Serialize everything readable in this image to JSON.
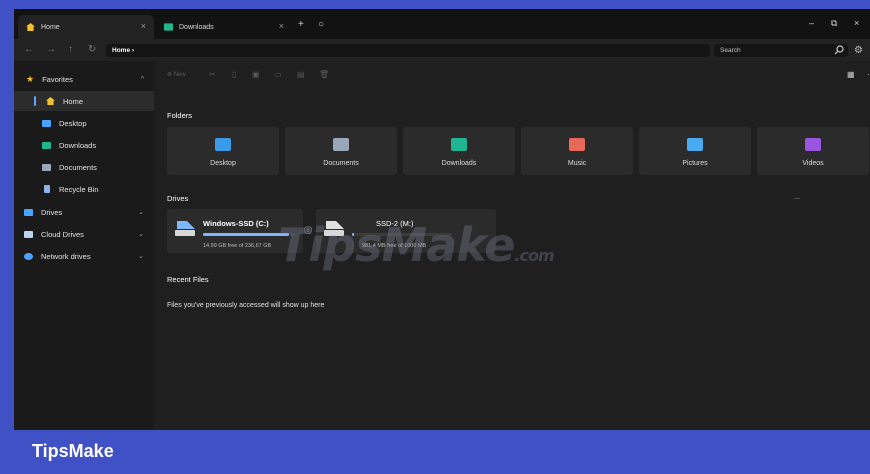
{
  "tabs": [
    {
      "label": "Home",
      "icon": "home-icon",
      "active": true
    },
    {
      "label": "Downloads",
      "icon": "downloads-folder-icon",
      "active": false
    }
  ],
  "window_controls": {
    "minimize": "–",
    "restore": "⧉",
    "close": "×"
  },
  "addressbar": {
    "path": "Home ›",
    "search_placeholder": "Search"
  },
  "sidebar": {
    "items": [
      {
        "label": "Favorites",
        "icon": "star-icon",
        "color": "#f2c12e",
        "chevron": "^"
      },
      {
        "label": "Home",
        "icon": "home-icon",
        "color": "#f2c12e",
        "selected": true
      },
      {
        "label": "Desktop",
        "icon": "desktop-folder-icon",
        "color": "#4aa3ff"
      },
      {
        "label": "Downloads",
        "icon": "downloads-folder-icon",
        "color": "#1fb58f"
      },
      {
        "label": "Documents",
        "icon": "documents-folder-icon",
        "color": "#9aa7b8"
      },
      {
        "label": "Recycle Bin",
        "icon": "recycle-bin-icon",
        "color": "#8fb2e8"
      },
      {
        "label": "Drives",
        "icon": "drive-icon",
        "color": "#4aa3ff",
        "chevron": "⌄"
      },
      {
        "label": "Cloud Drives",
        "icon": "cloud-icon",
        "color": "#bcd3ef",
        "chevron": "⌄"
      },
      {
        "label": "Network drives",
        "icon": "network-icon",
        "color": "#4aa3ff",
        "chevron": "⌄"
      }
    ]
  },
  "toolbar": {
    "new_label": "New"
  },
  "main": {
    "folders_title": "Folders",
    "folders": [
      {
        "label": "Desktop",
        "icon": "desktop-folder-icon",
        "color": "#3c9be8"
      },
      {
        "label": "Documents",
        "icon": "documents-folder-icon",
        "color": "#9aa7b8"
      },
      {
        "label": "Downloads",
        "icon": "downloads-folder-icon",
        "color": "#1fb58f"
      },
      {
        "label": "Music",
        "icon": "music-folder-icon",
        "color": "#e8685a"
      },
      {
        "label": "Pictures",
        "icon": "pictures-folder-icon",
        "color": "#4aa9f0"
      },
      {
        "label": "Videos",
        "icon": "videos-folder-icon",
        "color": "#9a55e0"
      }
    ],
    "drives_title": "Drives",
    "drives_more": "...",
    "drives": [
      {
        "name": "Windows-SSD (C:)",
        "free": "14,99 GB free of 236,67 GB",
        "used_fraction": 0.94
      },
      {
        "name": "SSD-2 (M:)",
        "free": "981,4 MB free of 1000 MB",
        "used_fraction": 0.02
      }
    ],
    "recent_title": "Recent Files",
    "recent_empty": "Files you've previously accessed will show up here"
  },
  "watermark": {
    "text": "TipsMake",
    "suffix": ".com"
  },
  "footer": {
    "brand": "TipsMake"
  },
  "colors": {
    "frame": "#3f51c4",
    "accent": "#5aa7ff"
  }
}
